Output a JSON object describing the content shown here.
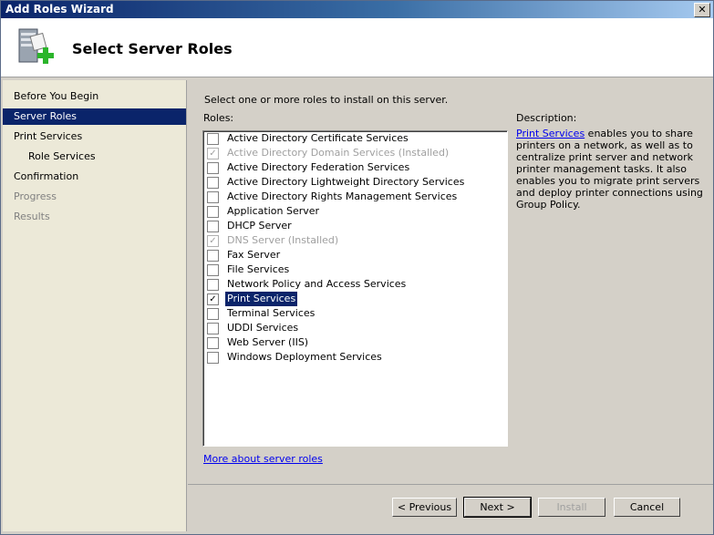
{
  "window": {
    "title": "Add Roles Wizard",
    "close_glyph": "✕"
  },
  "header": {
    "title": "Select Server Roles",
    "icon": "server-add-icon"
  },
  "nav": {
    "items": [
      {
        "label": "Before You Begin",
        "state": "normal",
        "sub": false
      },
      {
        "label": "Server Roles",
        "state": "selected",
        "sub": false
      },
      {
        "label": "Print Services",
        "state": "normal",
        "sub": false
      },
      {
        "label": "Role Services",
        "state": "normal",
        "sub": true
      },
      {
        "label": "Confirmation",
        "state": "normal",
        "sub": false
      },
      {
        "label": "Progress",
        "state": "disabled",
        "sub": false
      },
      {
        "label": "Results",
        "state": "disabled",
        "sub": false
      }
    ]
  },
  "main": {
    "intro": "Select one or more roles to install on this server.",
    "roles_label": "Roles:",
    "more_link": "More about server roles",
    "description_label": "Description:",
    "description_link": "Print Services",
    "description_text": " enables you to share printers on a network, as well as to centralize print server and network printer management tasks. It also enables you to migrate print servers and deploy printer connections using Group Policy.",
    "roles": [
      {
        "label": "Active Directory Certificate Services",
        "checked": false,
        "disabled": false,
        "selected": false
      },
      {
        "label": "Active Directory Domain Services  (Installed)",
        "checked": true,
        "disabled": true,
        "selected": false
      },
      {
        "label": "Active Directory Federation Services",
        "checked": false,
        "disabled": false,
        "selected": false
      },
      {
        "label": "Active Directory Lightweight Directory Services",
        "checked": false,
        "disabled": false,
        "selected": false
      },
      {
        "label": "Active Directory Rights Management Services",
        "checked": false,
        "disabled": false,
        "selected": false
      },
      {
        "label": "Application Server",
        "checked": false,
        "disabled": false,
        "selected": false
      },
      {
        "label": "DHCP Server",
        "checked": false,
        "disabled": false,
        "selected": false
      },
      {
        "label": "DNS Server  (Installed)",
        "checked": true,
        "disabled": true,
        "selected": false
      },
      {
        "label": "Fax Server",
        "checked": false,
        "disabled": false,
        "selected": false
      },
      {
        "label": "File Services",
        "checked": false,
        "disabled": false,
        "selected": false
      },
      {
        "label": "Network Policy and Access Services",
        "checked": false,
        "disabled": false,
        "selected": false
      },
      {
        "label": "Print Services",
        "checked": true,
        "disabled": false,
        "selected": true
      },
      {
        "label": "Terminal Services",
        "checked": false,
        "disabled": false,
        "selected": false
      },
      {
        "label": "UDDI Services",
        "checked": false,
        "disabled": false,
        "selected": false
      },
      {
        "label": "Web Server (IIS)",
        "checked": false,
        "disabled": false,
        "selected": false
      },
      {
        "label": "Windows Deployment Services",
        "checked": false,
        "disabled": false,
        "selected": false
      }
    ]
  },
  "footer": {
    "previous": "< Previous",
    "next": "Next >",
    "install": "Install",
    "cancel": "Cancel"
  }
}
